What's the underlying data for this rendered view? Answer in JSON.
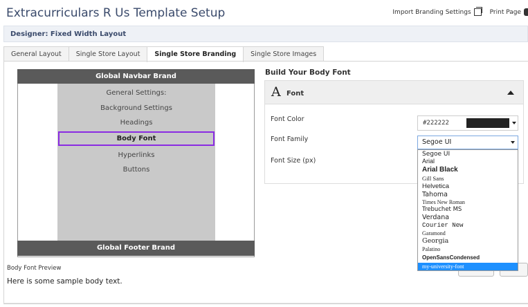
{
  "header": {
    "title": "Extracurriculars R Us Template Setup",
    "import_label": "Import Branding Settings",
    "print_label": "Print Page"
  },
  "designer": {
    "label": "Designer: Fixed Width Layout"
  },
  "tabs": [
    {
      "label": "General Layout"
    },
    {
      "label": "Single Store Layout"
    },
    {
      "label": "Single Store Branding"
    },
    {
      "label": "Single Store Images"
    }
  ],
  "preview": {
    "navbar": "Global Navbar Brand",
    "footer": "Global Footer Brand",
    "items": [
      "General Settings:",
      "Background Settings",
      "Headings",
      "Body Font",
      "Hyperlinks",
      "Buttons"
    ],
    "body_preview_label": "Body Font Preview",
    "sample_text": "Here is some sample body text."
  },
  "builder": {
    "title": "Build Your Body Font",
    "card_title": "Font",
    "font_color_label": "Font Color",
    "font_color_value": "#222222",
    "font_family_label": "Font Family",
    "font_family_value": "Segoe UI",
    "font_size_label": "Font Size (px)",
    "font_options": [
      "Segoe UI",
      "Arial",
      "Arial Black",
      "Gill Sans",
      "Helvetica",
      "Tahoma",
      "Times New Roman",
      "Trebuchet MS",
      "Verdana",
      "Courier New",
      "Garamond",
      "Georgia",
      "Palatino",
      "OpenSansCondensed",
      "my-university-font"
    ],
    "highlighted_option": "my-university-font"
  },
  "colors": {
    "accent_purple": "#8a2be2",
    "brand_gray": "#5a5a5a",
    "highlight_blue": "#1e90ff",
    "swatch": "#222222"
  }
}
